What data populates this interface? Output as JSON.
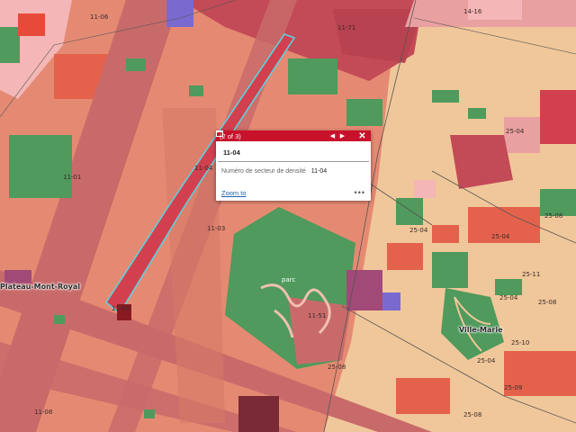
{
  "map": {
    "sector_labels": [
      {
        "id": "l1",
        "text": "11-06"
      },
      {
        "id": "l2",
        "text": "11-71"
      },
      {
        "id": "l3",
        "text": "14-16"
      },
      {
        "id": "l4",
        "text": "11-01"
      },
      {
        "id": "l5",
        "text": "11-04"
      },
      {
        "id": "l6",
        "text": "11-03"
      },
      {
        "id": "l7",
        "text": "parc"
      },
      {
        "id": "l8",
        "text": "11-51"
      },
      {
        "id": "l9",
        "text": "11-06"
      },
      {
        "id": "l10",
        "text": "11-08"
      },
      {
        "id": "l11",
        "text": "25-04"
      },
      {
        "id": "l12",
        "text": "25-08"
      },
      {
        "id": "l13",
        "text": "25-04"
      },
      {
        "id": "l14",
        "text": "25-11"
      },
      {
        "id": "l15",
        "text": "25-04"
      },
      {
        "id": "l16",
        "text": "25-08"
      },
      {
        "id": "l17",
        "text": "25-04"
      },
      {
        "id": "l18",
        "text": "25-10"
      },
      {
        "id": "l19",
        "text": "25-08"
      },
      {
        "id": "l20",
        "text": "25-08"
      },
      {
        "id": "l21",
        "text": "25-09"
      },
      {
        "id": "l22",
        "text": "25-04"
      }
    ],
    "place_names": {
      "plateau": "Plateau-Mont-Royal",
      "ville_marie": "Ville-Marie"
    }
  },
  "popup": {
    "counter": "(2 of 3)",
    "title": "11-04",
    "attribute_label": "Numéro de secteur de densité",
    "attribute_value": "11-04",
    "zoom_label": "Zoom to",
    "more_label": "•••",
    "icons": [
      "prev-arrow-icon",
      "next-arrow-icon",
      "dock-icon",
      "close-icon"
    ]
  },
  "colors": {
    "salmon": "#e58a72",
    "rose": "#c96a6a",
    "dark_red": "#b8424f",
    "green": "#4f9a5c",
    "beige": "#f0c79a",
    "pink": "#f4b6b6",
    "popup_header": "#c8122b",
    "highlight": "#5fd0dc"
  }
}
